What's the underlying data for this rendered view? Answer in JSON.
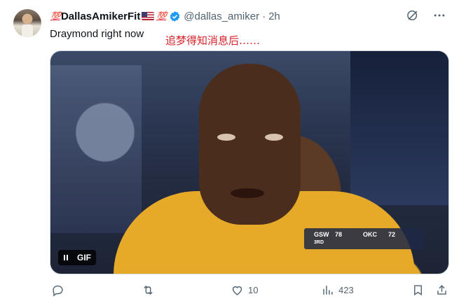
{
  "tweet": {
    "display_name": "DallasAmikerFit",
    "name_emoji_before": "💯",
    "name_emoji_after": "💯",
    "handle": "@dallas_amiker",
    "separator": "·",
    "time": "2h",
    "text": "Draymond right now",
    "overlay_text": "追梦得知消息后……"
  },
  "media": {
    "badge_label": "GIF",
    "scorebug": {
      "team_left": "GSW",
      "score_left": "78",
      "team_right": "OKC",
      "score_right": "72",
      "period": "3RD"
    }
  },
  "actions": {
    "reply_count": "",
    "retweet_count": "",
    "like_count": "10",
    "views_count": "423"
  },
  "icons": {
    "verified": "verified-badge-icon",
    "grok": "grok-icon",
    "more": "more-icon",
    "reply": "reply-icon",
    "retweet": "retweet-icon",
    "like": "heart-icon",
    "views": "views-icon",
    "bookmark": "bookmark-icon",
    "share": "share-icon"
  },
  "colors": {
    "verified_blue": "#1d9bf0",
    "secondary_text": "#536471",
    "overlay_red": "#d9222a"
  }
}
